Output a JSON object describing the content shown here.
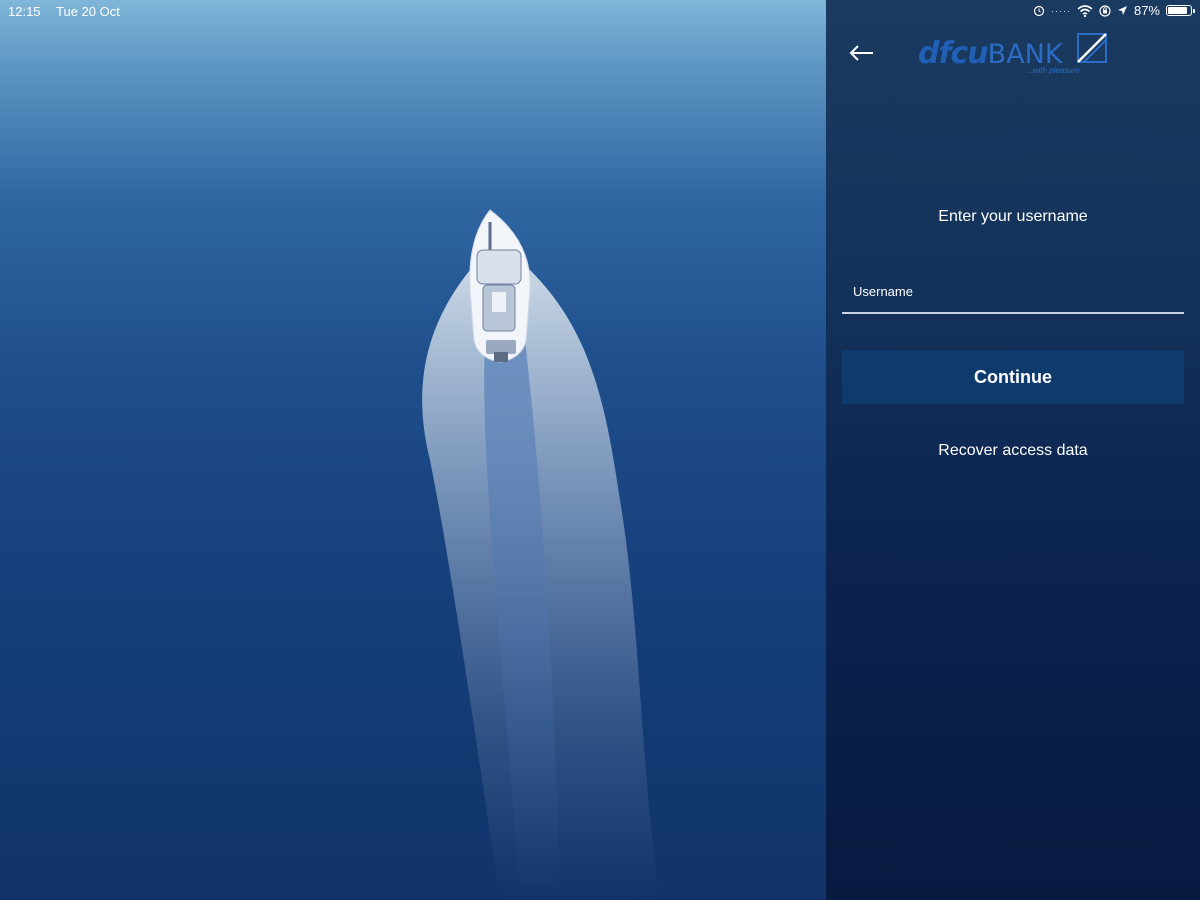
{
  "status_bar": {
    "time": "12:15",
    "date": "Tue 20 Oct",
    "battery_percent": "87%",
    "battery_level": 0.87
  },
  "header": {
    "back_icon": "arrow-left-icon",
    "logo_dfcu": "dfcu",
    "logo_bank": "BANK",
    "logo_tagline": "...with pleasure"
  },
  "login": {
    "prompt": "Enter your username",
    "username_label": "Username",
    "username_value": "",
    "continue_label": "Continue",
    "recover_label": "Recover access data"
  },
  "colors": {
    "panel_top": "#1b3a5f",
    "panel_bottom": "#071a40",
    "button": "#0f3a6e",
    "brand": "#1f5fb5",
    "text": "#ffffff"
  }
}
